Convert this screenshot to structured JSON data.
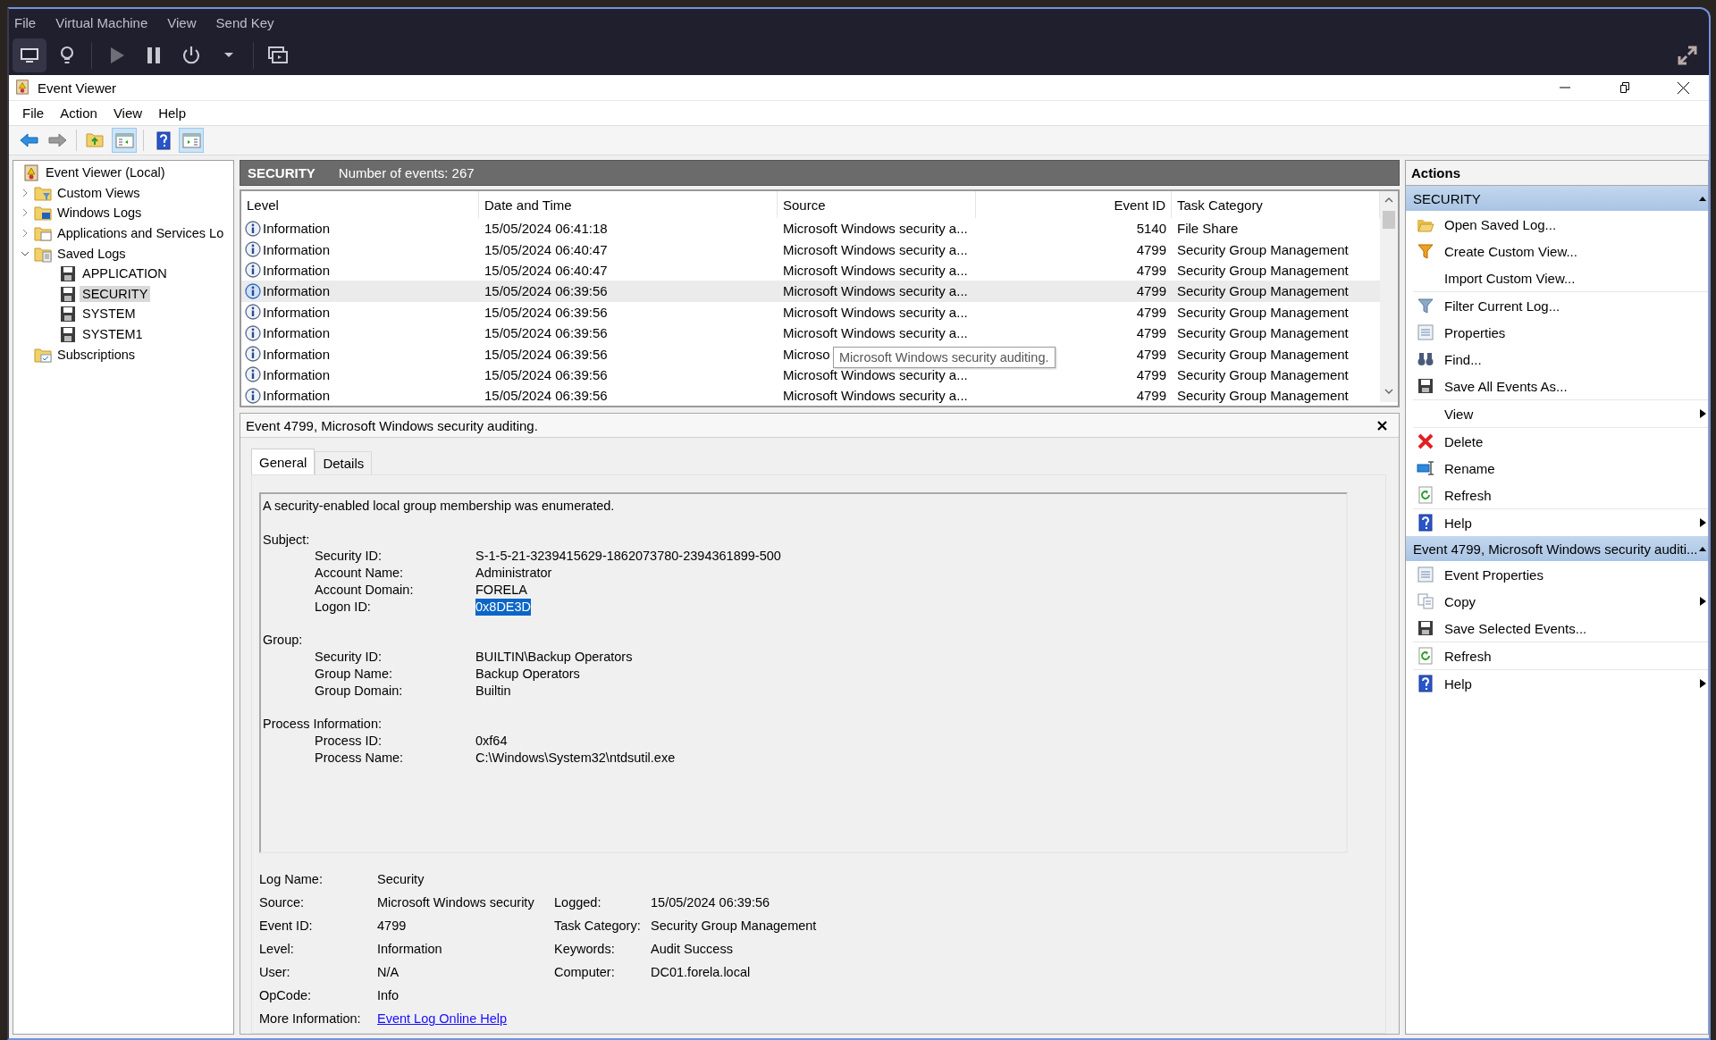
{
  "vm_menu": [
    "File",
    "Virtual Machine",
    "View",
    "Send Key"
  ],
  "vm_toolbar": [
    {
      "kind": "monitor",
      "on": true
    },
    {
      "kind": "bulb",
      "on": false
    },
    {
      "kind": "play",
      "on": false
    },
    {
      "kind": "pause",
      "on": false
    },
    {
      "kind": "power",
      "on": false
    },
    {
      "kind": "dropdown",
      "on": false
    },
    {
      "kind": "screens",
      "on": false
    }
  ],
  "window": {
    "title": "Event Viewer"
  },
  "menu": [
    "File",
    "Action",
    "View",
    "Help"
  ],
  "toolbar": [
    {
      "kind": "back",
      "on": false
    },
    {
      "kind": "forward",
      "on": false
    },
    {
      "kind": "up",
      "on": false
    },
    {
      "kind": "tree",
      "on": true
    },
    {
      "kind": "help",
      "on": false
    },
    {
      "kind": "actions",
      "on": true
    }
  ],
  "tree": [
    {
      "label": "Event Viewer (Local)",
      "kind": "root",
      "selected": false,
      "children": [
        {
          "label": "Custom Views",
          "kind": "views",
          "expanded": false,
          "selected": false
        },
        {
          "label": "Windows Logs",
          "kind": "windows",
          "expanded": false,
          "selected": false
        },
        {
          "label": "Applications and Services Lo",
          "kind": "apps",
          "expanded": false,
          "selected": false
        },
        {
          "label": "Saved Logs",
          "kind": "saved",
          "expanded": true,
          "selected": false,
          "children": [
            {
              "label": "APPLICATION",
              "kind": "log",
              "selected": false
            },
            {
              "label": "SECURITY",
              "kind": "log",
              "selected": true
            },
            {
              "label": "SYSTEM",
              "kind": "log",
              "selected": false
            },
            {
              "label": "SYSTEM1",
              "kind": "log",
              "selected": false
            }
          ]
        },
        {
          "label": "Subscriptions",
          "kind": "subscriptions",
          "selected": false
        }
      ]
    }
  ],
  "log_header": {
    "title": "SECURITY",
    "count": "Number of events: 267"
  },
  "table": {
    "columns": [
      "Level",
      "Date and Time",
      "Source",
      "Event ID",
      "Task Category"
    ],
    "rows": [
      {
        "level": "Information",
        "datetime": "15/05/2024 06:41:18",
        "source": "Microsoft Windows security a...",
        "event_id": "5140",
        "category": "File Share",
        "selected": false
      },
      {
        "level": "Information",
        "datetime": "15/05/2024 06:40:47",
        "source": "Microsoft Windows security a...",
        "event_id": "4799",
        "category": "Security Group Management",
        "selected": false
      },
      {
        "level": "Information",
        "datetime": "15/05/2024 06:40:47",
        "source": "Microsoft Windows security a...",
        "event_id": "4799",
        "category": "Security Group Management",
        "selected": false
      },
      {
        "level": "Information",
        "datetime": "15/05/2024 06:39:56",
        "source": "Microsoft Windows security a...",
        "event_id": "4799",
        "category": "Security Group Management",
        "selected": true
      },
      {
        "level": "Information",
        "datetime": "15/05/2024 06:39:56",
        "source": "Microsoft Windows security a...",
        "event_id": "4799",
        "category": "Security Group Management",
        "selected": false
      },
      {
        "level": "Information",
        "datetime": "15/05/2024 06:39:56",
        "source": "Microsoft Windows security a...",
        "event_id": "4799",
        "category": "Security Group Management",
        "selected": false
      },
      {
        "level": "Information",
        "datetime": "15/05/2024 06:39:56",
        "source": "Microso",
        "event_id": "4799",
        "category": "Security Group Management",
        "selected": false,
        "tooltip": "Microsoft Windows security auditing."
      },
      {
        "level": "Information",
        "datetime": "15/05/2024 06:39:56",
        "source": "Microsoft Windows security a...",
        "event_id": "4799",
        "category": "Security Group Management",
        "selected": false
      },
      {
        "level": "Information",
        "datetime": "15/05/2024 06:39:56",
        "source": "Microsoft Windows security a...",
        "event_id": "4799",
        "category": "Security Group Management",
        "selected": false
      }
    ]
  },
  "detail": {
    "title": "Event 4799, Microsoft Windows security auditing.",
    "tabs": [
      {
        "label": "General",
        "selected": true
      },
      {
        "label": "Details",
        "selected": false
      }
    ],
    "message": "A security-enabled local group membership was enumerated.",
    "sections": [
      {
        "heading": "Subject:",
        "fields": [
          {
            "label": "Security ID:",
            "value": "S-1-5-21-3239415629-1862073780-2394361899-500",
            "highlighted": false
          },
          {
            "label": "Account Name:",
            "value": "Administrator",
            "highlighted": false
          },
          {
            "label": "Account Domain:",
            "value": "FORELA",
            "highlighted": false
          },
          {
            "label": "Logon ID:",
            "value": "0x8DE3D",
            "highlighted": true
          }
        ]
      },
      {
        "heading": "Group:",
        "fields": [
          {
            "label": "Security ID:",
            "value": "BUILTIN\\Backup Operators",
            "highlighted": false
          },
          {
            "label": "Group Name:",
            "value": "Backup Operators",
            "highlighted": false
          },
          {
            "label": "Group Domain:",
            "value": "Builtin",
            "highlighted": false
          }
        ]
      },
      {
        "heading": "Process Information:",
        "fields": [
          {
            "label": "Process ID:",
            "value": "0xf64",
            "highlighted": false
          },
          {
            "label": "Process Name:",
            "value": "C:\\Windows\\System32\\ntdsutil.exe",
            "highlighted": false
          }
        ]
      }
    ],
    "summary_left": [
      {
        "label": "Log Name:",
        "value": "Security"
      },
      {
        "label": "Source:",
        "value": "Microsoft Windows security"
      },
      {
        "label": "Event ID:",
        "value": "4799"
      },
      {
        "label": "Level:",
        "value": "Information"
      },
      {
        "label": "User:",
        "value": "N/A"
      },
      {
        "label": "OpCode:",
        "value": "Info"
      },
      {
        "label": "More Information:",
        "link": "Event Log Online Help"
      }
    ],
    "summary_right": [
      {
        "label": "Logged:",
        "value": "15/05/2024 06:39:56"
      },
      {
        "label": "Task Category:",
        "value": "Security Group Management"
      },
      {
        "label": "Keywords:",
        "value": "Audit Success"
      },
      {
        "label": "Computer:",
        "value": "DC01.forela.local"
      }
    ]
  },
  "actions": {
    "title": "Actions",
    "sections": [
      {
        "title": "SECURITY",
        "groups": [
          [
            {
              "label": "Open Saved Log...",
              "kind": "open",
              "submenu": false
            },
            {
              "label": "Create Custom View...",
              "kind": "funnel",
              "submenu": false
            },
            {
              "label": "Import Custom View...",
              "kind": "none",
              "submenu": false
            }
          ],
          [
            {
              "label": "Filter Current Log...",
              "kind": "filter",
              "submenu": false
            },
            {
              "label": "Properties",
              "kind": "properties",
              "submenu": false
            },
            {
              "label": "Find...",
              "kind": "find",
              "submenu": false
            },
            {
              "label": "Save All Events As...",
              "kind": "save",
              "submenu": false
            }
          ],
          [
            {
              "label": "View",
              "kind": "none",
              "submenu": true
            }
          ],
          [
            {
              "label": "Delete",
              "kind": "delete",
              "submenu": false
            },
            {
              "label": "Rename",
              "kind": "rename",
              "submenu": false
            },
            {
              "label": "Refresh",
              "kind": "refresh",
              "submenu": false
            }
          ],
          [
            {
              "label": "Help",
              "kind": "help",
              "submenu": true
            }
          ]
        ]
      },
      {
        "title": "Event 4799, Microsoft Windows security auditi...",
        "groups": [
          [
            {
              "label": "Event Properties",
              "kind": "properties",
              "submenu": false
            },
            {
              "label": "Copy",
              "kind": "copy",
              "submenu": true
            },
            {
              "label": "Save Selected Events...",
              "kind": "save",
              "submenu": false
            }
          ],
          [
            {
              "label": "Refresh",
              "kind": "refresh",
              "submenu": false
            }
          ],
          [
            {
              "label": "Help",
              "kind": "help",
              "submenu": true
            }
          ]
        ]
      }
    ]
  }
}
